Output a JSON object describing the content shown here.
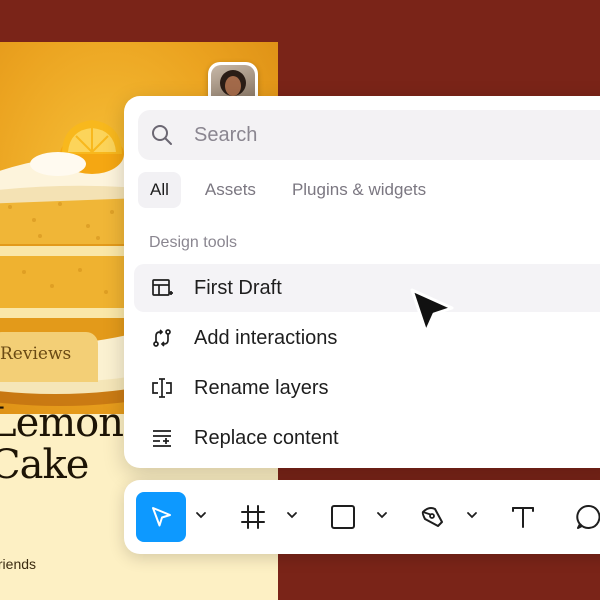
{
  "artboard": {
    "reviews_tab": "Reviews",
    "title_line1": "Lemon",
    "title_line2": "Cake",
    "subtitle": "friends"
  },
  "search": {
    "placeholder": "Search",
    "value": ""
  },
  "tabs": [
    {
      "label": "All",
      "active": true
    },
    {
      "label": "Assets",
      "active": false
    },
    {
      "label": "Plugins & widgets",
      "active": false
    }
  ],
  "section": {
    "label": "Design tools"
  },
  "menu": [
    {
      "label": "First Draft",
      "icon": "first-draft-icon",
      "highlighted": true
    },
    {
      "label": "Add interactions",
      "icon": "interactions-icon",
      "highlighted": false
    },
    {
      "label": "Rename layers",
      "icon": "rename-icon",
      "highlighted": false
    },
    {
      "label": "Replace content",
      "icon": "replace-content-icon",
      "highlighted": false
    }
  ],
  "toolbar": {
    "tools": [
      "move-tool",
      "frame-tool",
      "shape-tool",
      "pen-tool",
      "text-tool",
      "comment-tool"
    ],
    "active_tool": "move-tool",
    "accent": "#0d99ff"
  },
  "colors": {
    "background": "#7a2418",
    "panel": "#ffffff",
    "accent": "#0d99ff"
  }
}
